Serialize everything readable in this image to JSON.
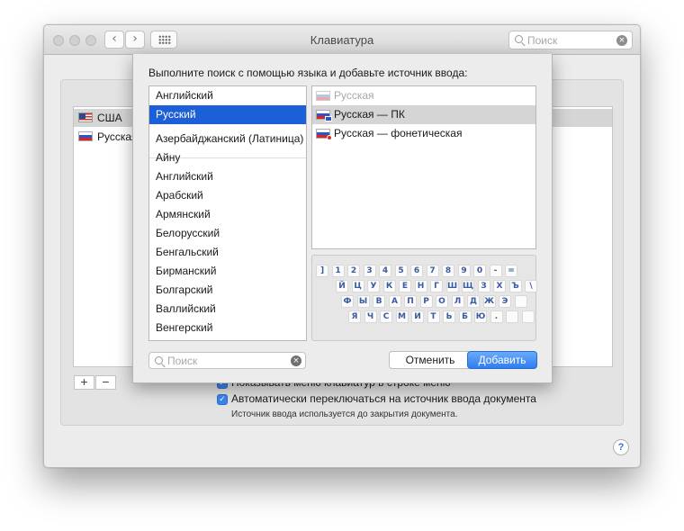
{
  "window": {
    "title": "Клавиатура",
    "search_placeholder": "Поиск",
    "nav_back": "‹",
    "nav_forward": "›",
    "clear_glyph": "×"
  },
  "sources": {
    "items": [
      {
        "label": "США",
        "flag": "us",
        "selected": true
      },
      {
        "label": "Русская",
        "flag": "ru",
        "selected": false
      }
    ],
    "add_glyph": "+",
    "remove_glyph": "−"
  },
  "options": {
    "show_menu_label": "Показывать меню клавиатур в строке меню",
    "auto_switch_label": "Автоматически переключаться на источник ввода документа",
    "note": "Источник ввода используется до закрытия документа.",
    "check_glyph": "✓",
    "help_glyph": "?"
  },
  "sheet": {
    "heading": "Выполните поиск с помощью языка и добавьте источник ввода:",
    "languages": [
      "Английский",
      "Русский",
      "Азербайджанский (Латиница)",
      "Айну",
      "Английский",
      "Арабский",
      "Армянский",
      "Белорусский",
      "Бенгальский",
      "Бирманский",
      "Болгарский",
      "Валлийский",
      "Венгерский"
    ],
    "selected_language": "Русский",
    "input_sources": [
      {
        "label": "Русская",
        "disabled": true
      },
      {
        "label": "Русская — ПК",
        "selected": true
      },
      {
        "label": "Русская — фонетическая"
      }
    ],
    "keyboard_rows": [
      [
        "]",
        "1",
        "2",
        "3",
        "4",
        "5",
        "6",
        "7",
        "8",
        "9",
        "0",
        "-",
        "="
      ],
      [
        "Й",
        "Ц",
        "У",
        "К",
        "Е",
        "Н",
        "Г",
        "Ш",
        "Щ",
        "З",
        "Х",
        "Ъ",
        "\\"
      ],
      [
        "Ф",
        "Ы",
        "В",
        "А",
        "П",
        "Р",
        "О",
        "Л",
        "Д",
        "Ж",
        "Э"
      ],
      [
        "Я",
        "Ч",
        "С",
        "М",
        "И",
        "Т",
        "Ь",
        "Б",
        "Ю",
        "."
      ]
    ],
    "search_placeholder": "Поиск",
    "cancel_label": "Отменить",
    "add_label": "Добавить"
  }
}
